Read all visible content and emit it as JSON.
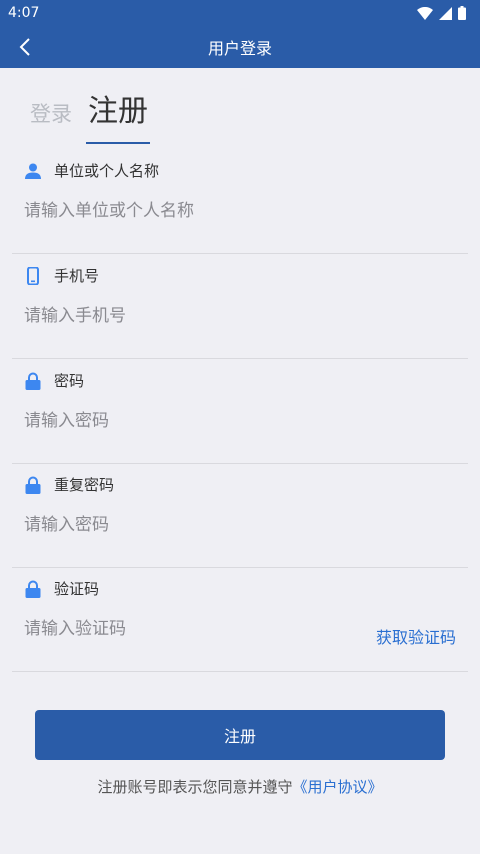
{
  "status_bar": {
    "time": "4:07"
  },
  "header": {
    "title": "用户登录"
  },
  "tabs": {
    "login": "登录",
    "register": "注册"
  },
  "form": {
    "name": {
      "label": "单位或个人名称",
      "placeholder": "请输入单位或个人名称",
      "icon": "person-icon"
    },
    "phone": {
      "label": "手机号",
      "placeholder": "请输入手机号",
      "icon": "phone-icon"
    },
    "password": {
      "label": "密码",
      "placeholder": "请输入密码",
      "icon": "lock-icon"
    },
    "repeat_password": {
      "label": "重复密码",
      "placeholder": "请输入密码",
      "icon": "lock-icon"
    },
    "code": {
      "label": "验证码",
      "placeholder": "请输入验证码",
      "icon": "lock-icon",
      "get_code_label": "获取验证码"
    }
  },
  "submit_label": "注册",
  "agreement": {
    "text": "注册账号即表示您同意并遵守",
    "link": "《用户协议》"
  },
  "colors": {
    "primary": "#2a5ca8",
    "link": "#2a6fd1",
    "icon": "#3d87f0"
  }
}
